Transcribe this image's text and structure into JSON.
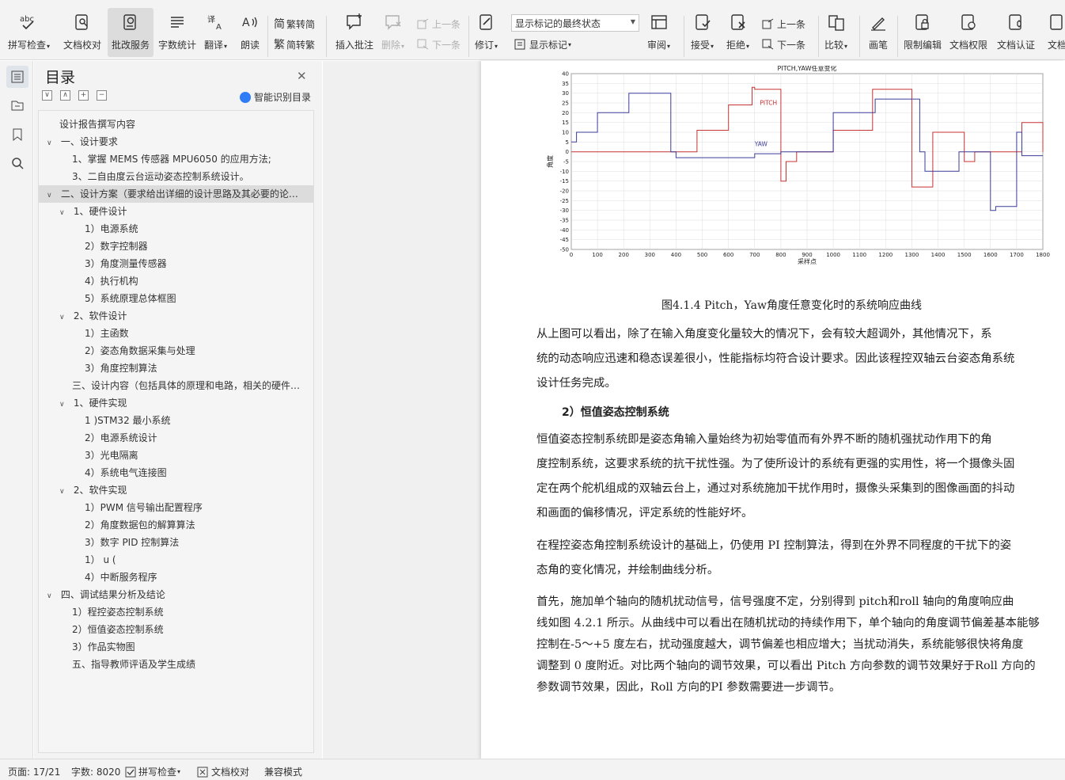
{
  "ribbon": {
    "spell_check": "拼写检查",
    "doc_proof": "文档校对",
    "batch_service": "批改服务",
    "word_count": "字数统计",
    "translate": "翻译",
    "read_aloud": "朗读",
    "trad_to_simp": "繁转简",
    "simp_to_trad": "简转繁",
    "insert_comment": "插入批注",
    "delete": "删除",
    "prev_comment": "上一条",
    "next_comment": "下一条",
    "revise": "修订",
    "markup_state": "显示标记的最终状态",
    "show_markup": "显示标记",
    "review": "审阅",
    "accept": "接受",
    "reject": "拒绝",
    "prev_change": "上一条",
    "next_change": "下一条",
    "compare": "比较",
    "pen": "画笔",
    "restrict_edit": "限制编辑",
    "doc_permission": "文档权限",
    "doc_cert": "文档认证",
    "doc_more": "文档"
  },
  "toc": {
    "title": "目录",
    "smart_toc": "智能识别目录",
    "items": [
      {
        "text": "设计报告撰写内容",
        "indent": 0,
        "arrow": ""
      },
      {
        "text": "一、设计要求",
        "indent": 0,
        "arrow": "∨"
      },
      {
        "text": "1、掌握 MEMS 传感器 MPU6050 的应用方法;",
        "indent": 1,
        "arrow": ""
      },
      {
        "text": "3、二自由度云台运动姿态控制系统设计。",
        "indent": 1,
        "arrow": ""
      },
      {
        "text": "二、设计方案（要求给出详细的设计思路及其必要的论…",
        "indent": 0,
        "arrow": "∨"
      },
      {
        "text": "1、硬件设计",
        "indent": 1,
        "arrow": "∨"
      },
      {
        "text": "1）电源系统",
        "indent": 2,
        "arrow": ""
      },
      {
        "text": "2）数字控制器",
        "indent": 2,
        "arrow": ""
      },
      {
        "text": "3）角度测量传感器",
        "indent": 2,
        "arrow": ""
      },
      {
        "text": "4）执行机构",
        "indent": 2,
        "arrow": ""
      },
      {
        "text": "5）系统原理总体框图",
        "indent": 2,
        "arrow": ""
      },
      {
        "text": "2、软件设计",
        "indent": 1,
        "arrow": "∨"
      },
      {
        "text": "1）主函数",
        "indent": 2,
        "arrow": ""
      },
      {
        "text": "2）姿态角数据采集与处理",
        "indent": 2,
        "arrow": ""
      },
      {
        "text": "3）角度控制算法",
        "indent": 2,
        "arrow": ""
      },
      {
        "text": "三、设计内容（包括具体的原理和电路，相关的硬件…",
        "indent": 1,
        "arrow": ""
      },
      {
        "text": "1、硬件实现",
        "indent": 1,
        "arrow": "∨"
      },
      {
        "text": "1 )STM32 最小系统",
        "indent": 2,
        "arrow": ""
      },
      {
        "text": "2）电源系统设计",
        "indent": 2,
        "arrow": ""
      },
      {
        "text": "3）光电隔离",
        "indent": 2,
        "arrow": ""
      },
      {
        "text": "4）系统电气连接图",
        "indent": 2,
        "arrow": ""
      },
      {
        "text": "2、软件实现",
        "indent": 1,
        "arrow": "∨"
      },
      {
        "text": "1）PWM 信号输出配置程序",
        "indent": 2,
        "arrow": ""
      },
      {
        "text": "2）角度数据包的解算算法",
        "indent": 2,
        "arrow": ""
      },
      {
        "text": "3）数字 PID 控制算法",
        "indent": 2,
        "arrow": ""
      },
      {
        "text": "1）      u (",
        "indent": 2,
        "arrow": ""
      },
      {
        "text": "4）中断服务程序",
        "indent": 2,
        "arrow": ""
      },
      {
        "text": "四、调试结果分析及结论",
        "indent": 0,
        "arrow": "∨"
      },
      {
        "text": "1）程控姿态控制系统",
        "indent": 1,
        "arrow": ""
      },
      {
        "text": "2）恒值姿态控制系统",
        "indent": 1,
        "arrow": ""
      },
      {
        "text": "3）作品实物图",
        "indent": 1,
        "arrow": ""
      },
      {
        "text": "五、指导教师评语及学生成绩",
        "indent": 1,
        "arrow": ""
      }
    ]
  },
  "chart_data": {
    "type": "line",
    "title": "PITCH,YAW任意变化",
    "xlabel": "采样点",
    "ylabel": "角度",
    "xlim": [
      0,
      1800
    ],
    "ylim": [
      -50,
      40
    ],
    "xticks": [
      0,
      100,
      200,
      300,
      400,
      500,
      600,
      700,
      800,
      900,
      1000,
      1100,
      1200,
      1300,
      1400,
      1500,
      1600,
      1700,
      1800
    ],
    "yticks": [
      40,
      35,
      30,
      25,
      20,
      15,
      10,
      5,
      0,
      -5,
      -10,
      -15,
      -20,
      -25,
      -30,
      -35,
      -40,
      -45,
      -50
    ],
    "grid": true,
    "annotations": [
      "PITCH",
      "YAW"
    ],
    "series": [
      {
        "name": "PITCH",
        "color": "#c83232",
        "x": [
          0,
          400,
          440,
          480,
          510,
          560,
          600,
          620,
          680,
          690,
          700,
          760,
          790,
          800,
          820,
          860,
          930,
          970,
          1000,
          1010,
          1060,
          1120,
          1150,
          1170,
          1250,
          1260,
          1300,
          1380,
          1420,
          1440,
          1500,
          1540,
          1580,
          1620,
          1680,
          1700,
          1720,
          1800
        ],
        "y": [
          0,
          0,
          0,
          11,
          11,
          11,
          24,
          24,
          24,
          33,
          32,
          32,
          32,
          -15,
          -5,
          0,
          0,
          0,
          11,
          11,
          11,
          11,
          32,
          32,
          32,
          32,
          -18,
          10,
          10,
          10,
          -5,
          0,
          0,
          0,
          0,
          0,
          15,
          0
        ]
      },
      {
        "name": "YAW",
        "color": "#3c3c9a",
        "x": [
          0,
          20,
          60,
          100,
          140,
          160,
          220,
          260,
          300,
          360,
          380,
          400,
          420,
          480,
          560,
          620,
          700,
          740,
          760,
          800,
          860,
          920,
          960,
          1000,
          1030,
          1080,
          1140,
          1160,
          1200,
          1230,
          1280,
          1330,
          1350,
          1400,
          1450,
          1480,
          1530,
          1580,
          1600,
          1620,
          1680,
          1700,
          1720,
          1800
        ],
        "y": [
          5,
          10,
          10,
          20,
          20,
          20,
          30,
          30,
          30,
          30,
          0,
          -3,
          -3,
          -3,
          -3,
          -3,
          -1,
          -1,
          -1,
          0,
          0,
          0,
          0,
          20,
          20,
          20,
          20,
          27,
          27,
          27,
          27,
          0,
          -10,
          -10,
          -10,
          0,
          0,
          0,
          -30,
          -28,
          -28,
          10,
          -2,
          -2
        ]
      }
    ]
  },
  "doc": {
    "caption": "图4.1.4      Pitch，Yaw角度任意变化时的系统响应曲线",
    "para1": [
      "    从上图可以看出，除了在输入角度变化量较大的情况下，会有较大超调外，其他情况下，系",
      "统的动态响应迅速和稳态误差很小，性能指标均符合设计要求。因此该程控双轴云台姿态角系统",
      "设计任务完成。"
    ],
    "subhead": "2）恒值姿态控制系统",
    "para2": [
      "    恒值姿态控制系统即是姿态角输入量始终为初始零值而有外界不断的随机强扰动作用下的角",
      "度控制系统，这要求系统的抗干扰性强。为了使所设计的系统有更强的实用性，将一个摄像头固",
      "定在两个舵机组成的双轴云台上，通过对系统施加干扰作用时，摄像头采集到的图像画面的抖动",
      "和画面的偏移情况，评定系统的性能好坏。"
    ],
    "para3": [
      "    在程控姿态角控制系统设计的基础上，仍使用 PI 控制算法，得到在外界不同程度的干扰下的姿",
      "态角的变化情况，并绘制曲线分析。"
    ],
    "para4": [
      "    首先，施加单个轴向的随机扰动信号，信号强度不定，分别得到 pitch和roll 轴向的角度响应曲",
      "线如图 4.2.1 所示。从曲线中可以看出在随机扰动的持续作用下，单个轴向的角度调节偏差基本能够",
      "控制在-5～+5 度左右，扰动强度越大，调节偏差也相应增大；当扰动消失，系统能够很快将角度",
      "调整到 0 度附近。对比两个轴向的调节效果，可以看出 Pitch 方向参数的调节效果好于Roll 方向的",
      "参数调节效果，因此，Roll 方向的PI 参数需要进一步调节。"
    ]
  },
  "status": {
    "page": "页面: 17/21",
    "words": "字数: 8020",
    "spell": "拼写检查",
    "proof": "文档校对",
    "compat": "兼容模式"
  }
}
